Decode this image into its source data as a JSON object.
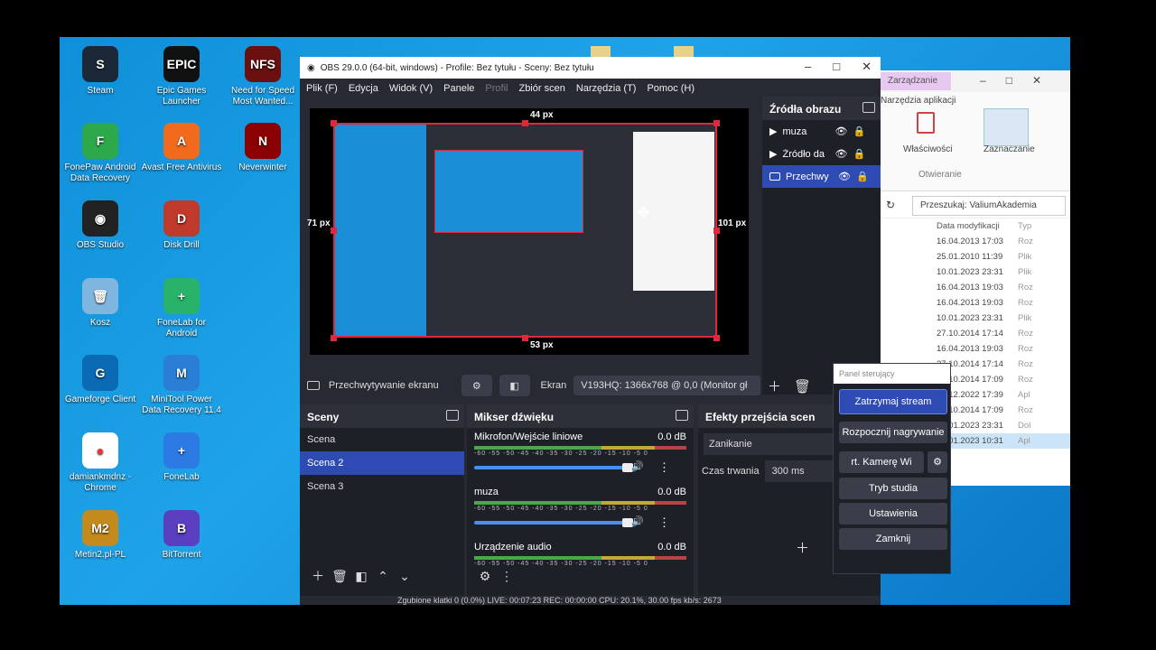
{
  "desktop_icons": [
    {
      "label": "Steam",
      "color": "#1b2838",
      "glyph": "S"
    },
    {
      "label": "Epic Games Launcher",
      "color": "#111",
      "glyph": "EPIC"
    },
    {
      "label": "Need for Speed Most Wanted...",
      "color": "#6a1010",
      "glyph": "NFS"
    },
    {
      "label": "FonePaw Android Data Recovery",
      "color": "#2da84a",
      "glyph": "F"
    },
    {
      "label": "Avast Free Antivirus",
      "color": "#f26b1d",
      "glyph": "A"
    },
    {
      "label": "Neverwinter",
      "color": "#8b0000",
      "glyph": "N"
    },
    {
      "label": "OBS Studio",
      "color": "#222",
      "glyph": "◉"
    },
    {
      "label": "Disk Drill",
      "color": "#c0392b",
      "glyph": "D"
    },
    {
      "label": "Kosz",
      "color": "#7fb6e0",
      "glyph": "🗑"
    },
    {
      "label": "FoneLab for Android",
      "color": "#29b36a",
      "glyph": "+"
    },
    {
      "label": "Gameforge Client",
      "color": "#0a6ab4",
      "glyph": "G"
    },
    {
      "label": "MiniTool Power Data Recovery 11.4",
      "color": "#2a7fd4",
      "glyph": "M"
    },
    {
      "label": "damiankmdnz - Chrome",
      "color": "#ffffff",
      "glyph": "●"
    },
    {
      "label": "FoneLab",
      "color": "#2c7be5",
      "glyph": "+"
    },
    {
      "label": "Metin2.pl-PL",
      "color": "#c58a1c",
      "glyph": "M2"
    },
    {
      "label": "BitTorrent",
      "color": "#5a3fc0",
      "glyph": "B"
    }
  ],
  "explorer": {
    "tab": "Zarządzanie",
    "subtitle": "Narzędzia aplikacji",
    "props": "Właściwości",
    "select": "Zaznaczanie",
    "open": "Otwieranie",
    "search": "Przeszukaj: ValiumAkademia",
    "col_date": "Data modyfikacji",
    "col_type": "Typ",
    "rows": [
      [
        "16.04.2013 17:03",
        "Roz"
      ],
      [
        "25.01.2010 11:39",
        "Plik"
      ],
      [
        "10.01.2023 23:31",
        "Plik"
      ],
      [
        "16.04.2013 19:03",
        "Roz"
      ],
      [
        "16.04.2013 19:03",
        "Roz"
      ],
      [
        "10.01.2023 23:31",
        "Plik"
      ],
      [
        "27.10.2014 17:14",
        "Roz"
      ],
      [
        "16.04.2013 19:03",
        "Roz"
      ],
      [
        "27.10.2014 17:14",
        "Roz"
      ],
      [
        "27.10.2014 17:09",
        "Roz"
      ],
      [
        "20.12.2022 17:39",
        "Apl"
      ],
      [
        "27.10.2014 17:09",
        "Roz"
      ],
      [
        "10.01.2023 23:31",
        "Dol"
      ],
      [
        "10.01.2023 10:31",
        "Apl"
      ]
    ]
  },
  "obs": {
    "title": "OBS 29.0.0 (64-bit, windows) - Profile: Bez tytułu - Sceny: Bez tytułu",
    "menu": [
      "Plik (F)",
      "Edycja",
      "Widok (V)",
      "Panele",
      "Profil",
      "Zbiór scen",
      "Narzędzia (T)",
      "Pomoc (H)"
    ],
    "preview_labels": {
      "top": "44 px",
      "left": "71 px",
      "right": "101 px",
      "bottom": "53 px"
    },
    "source_bar": {
      "name": "Przechwytywanie ekranu",
      "screen_label": "Ekran",
      "screen_value": "V193HQ: 1366x768 @ 0,0 (Monitor gł"
    },
    "sources_title": "Źródła obrazu",
    "sources": [
      "muza",
      "Źródło da",
      "Przechwy"
    ],
    "scenes_title": "Sceny",
    "scenes": [
      "Scena",
      "Scena 2",
      "Scena 3"
    ],
    "mixer_title": "Mikser dźwięku",
    "mixer": [
      {
        "name": "Mikrofon/Wejście liniowe",
        "db": "0.0 dB"
      },
      {
        "name": "muza",
        "db": "0.0 dB"
      },
      {
        "name": "Urządzenie audio",
        "db": "0.0 dB"
      }
    ],
    "ticks": "-60 -55 -50 -45 -40 -35 -30 -25 -20 -15 -10 -5 0",
    "transitions_title": "Efekty przejścia scen",
    "transition": "Zanikanie",
    "duration_label": "Czas trwania",
    "duration": "300 ms",
    "status": "Zgubione klatki 0 (0.0%)    LIVE: 00:07:23    REC: 00:00:00    CPU: 20.1%, 30.00 fps    kb/s: 2673"
  },
  "control_panel": {
    "title": "Panel sterujący",
    "buttons": [
      "Zatrzymaj stream",
      "Rozpocznij nagrywanie",
      "rt. Kamerę Wi",
      "Tryb studia",
      "Ustawienia",
      "Zamknij"
    ]
  }
}
